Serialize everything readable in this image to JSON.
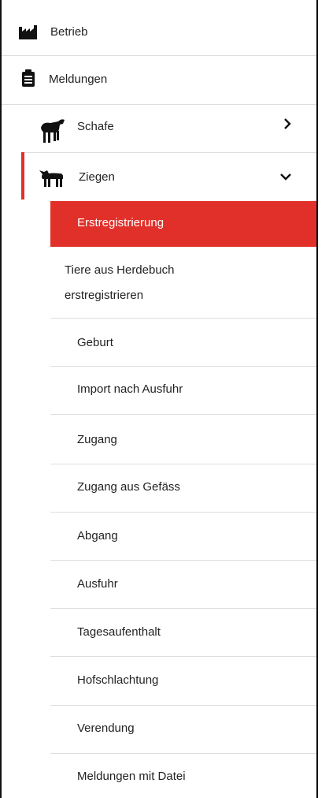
{
  "nav": {
    "betrieb": {
      "label": "Betrieb",
      "icon": "factory-icon"
    },
    "meldungen": {
      "label": "Meldungen",
      "icon": "clipboard-icon"
    },
    "schafe": {
      "label": "Schafe",
      "icon": "sheep-icon",
      "expand_icon": "chevron-right-icon"
    },
    "ziegen": {
      "label": "Ziegen",
      "icon": "goat-icon",
      "expand_icon": "chevron-down-icon"
    }
  },
  "ziegen_items": [
    {
      "label": "Erstregistrierung",
      "active": true
    },
    {
      "label_line1": "Tiere aus Herdebuch",
      "label_line2": "erstregistrieren"
    },
    {
      "label": "Geburt"
    },
    {
      "label": "Import nach Ausfuhr"
    },
    {
      "label": "Zugang"
    },
    {
      "label": "Zugang aus Gefäss"
    },
    {
      "label": "Abgang"
    },
    {
      "label": "Ausfuhr"
    },
    {
      "label": "Tagesaufenthalt"
    },
    {
      "label": "Hofschlachtung"
    },
    {
      "label": "Verendung"
    },
    {
      "label": "Meldungen mit Datei"
    }
  ],
  "colors": {
    "accent": "#e1302a",
    "separator": "#dedede"
  }
}
